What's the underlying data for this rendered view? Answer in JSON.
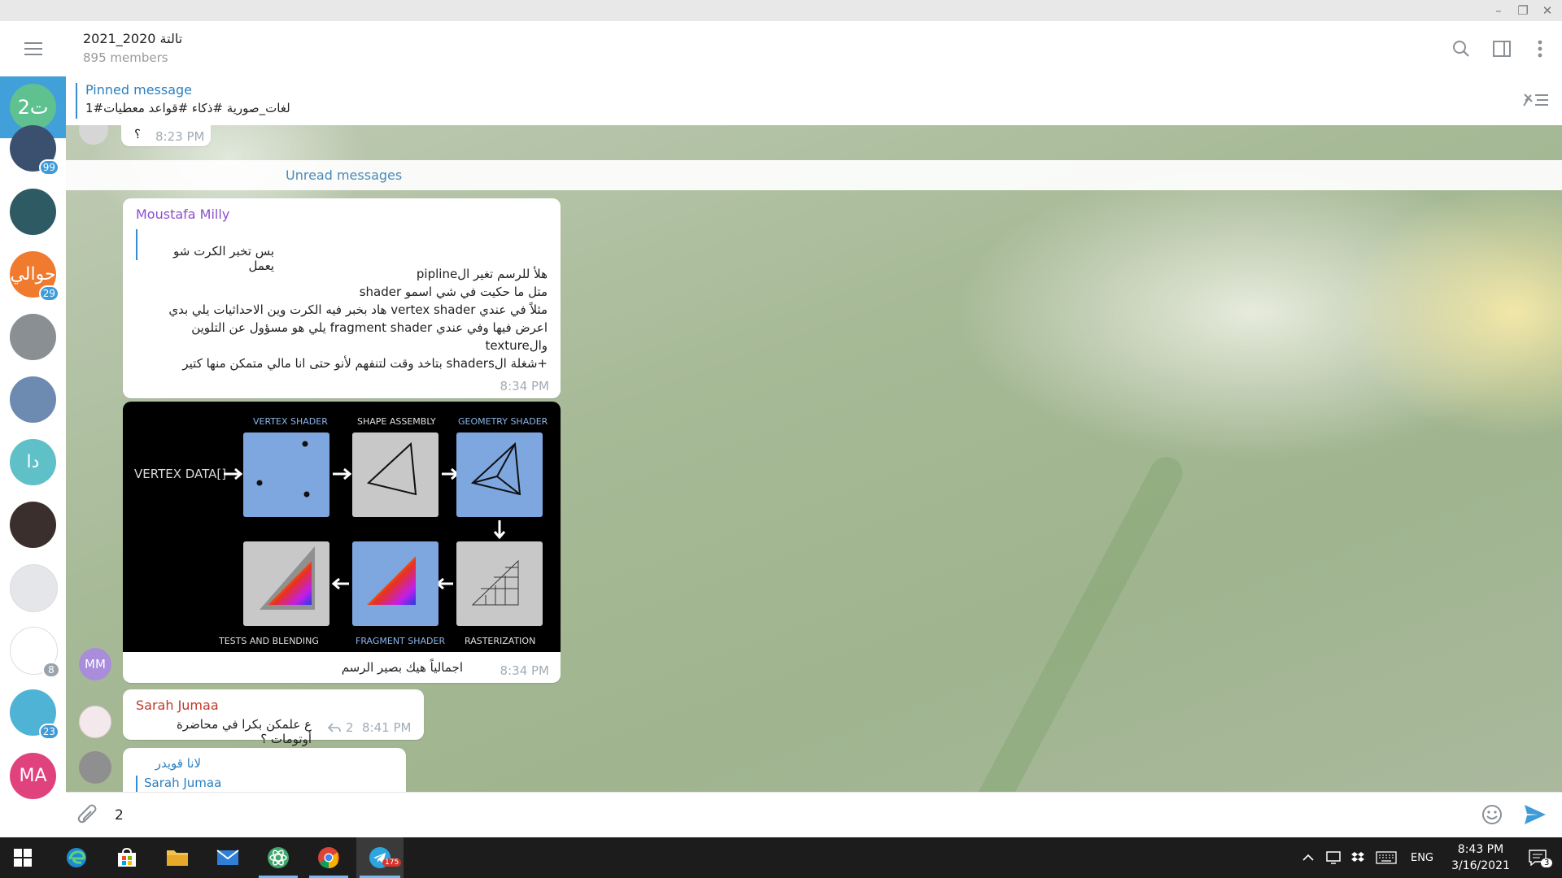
{
  "chat": {
    "title": "2021_2020 تالتة",
    "members": "895 members",
    "avatar_text": "2ت",
    "pinned_title": "Pinned message",
    "pinned_text": "لغات_صورية  #ذكاء #قواعد معطيات#1"
  },
  "sidebar_chats": [
    {
      "text": "",
      "badge": "99",
      "color": "#3b4f6e"
    },
    {
      "text": "",
      "badge": "",
      "color": "#2e5a64"
    },
    {
      "text": "حوالي",
      "badge": "29",
      "color": "#f07a2e"
    },
    {
      "text": "",
      "badge": "",
      "color": "#8a8f93"
    },
    {
      "text": "",
      "badge": "",
      "color": "#6d8bb0"
    },
    {
      "text": "دا",
      "badge": "",
      "color": "#5fc0c8"
    },
    {
      "text": "",
      "badge": "",
      "color": "#3a2f2c"
    },
    {
      "text": "",
      "badge": "",
      "color": "#e4e6e9"
    },
    {
      "text": "",
      "badge": "8",
      "color": "#ffffff"
    },
    {
      "text": "",
      "badge": "23",
      "color": "#4fb3d6"
    },
    {
      "text": "MA",
      "badge": "",
      "color": "#e0427d"
    }
  ],
  "messages": {
    "prev_time": "8:23 PM",
    "prev_text": "؟",
    "unread_label": "Unread messages",
    "m1": {
      "sender": "Moustafa Milly",
      "quote": "بس تخبر الكرت شو يعمل",
      "lines": [
        "هلأ للرسم تغير الpipline",
        "متل ما حكيت في شي اسمو shader",
        "مثلاً في عندي vertex shader هاد بخبر فيه الكرت وين الاحداثيات يلي بدي",
        "اعرض فيها وفي عندي fragment shader يلي هو مسؤول عن التلوين",
        "والtexture",
        "+شغلة الshaders بتاخد وقت لتنفهم لأنو حتى انا مالي متمكن منها كتير"
      ],
      "time": "8:34 PM"
    },
    "m2": {
      "avatar": "MM",
      "caption": "اجمالياً هيك بصير الرسم",
      "time": "8:34 PM",
      "diagram": {
        "vertex_data": "VERTEX DATA[]",
        "vertex_shader": "VERTEX SHADER",
        "shape_assembly": "SHAPE ASSEMBLY",
        "geometry_shader": "GEOMETRY SHADER",
        "tests_blending": "TESTS AND BLENDING",
        "fragment_shader": "FRAGMENT SHADER",
        "rasterization": "RASTERIZATION"
      }
    },
    "m3": {
      "sender": "Sarah Jumaa",
      "text": "ع علمكن بكرا في محاضرة أوتومات ؟",
      "replies": "2",
      "time": "8:41 PM"
    },
    "m4": {
      "sender": "لانا قويدر",
      "quote_sender": "Sarah Jumaa"
    }
  },
  "composer": {
    "value": "2"
  },
  "taskbar": {
    "lang": "ENG",
    "time": "8:43 PM",
    "date": "3/16/2021",
    "notif_count": "3",
    "telegram_badge": "175"
  },
  "colors": {
    "accent": "#419fd9",
    "sender_purple": "#8a4fd0",
    "sender_red": "#c0392b",
    "link": "#2a7fc0"
  }
}
